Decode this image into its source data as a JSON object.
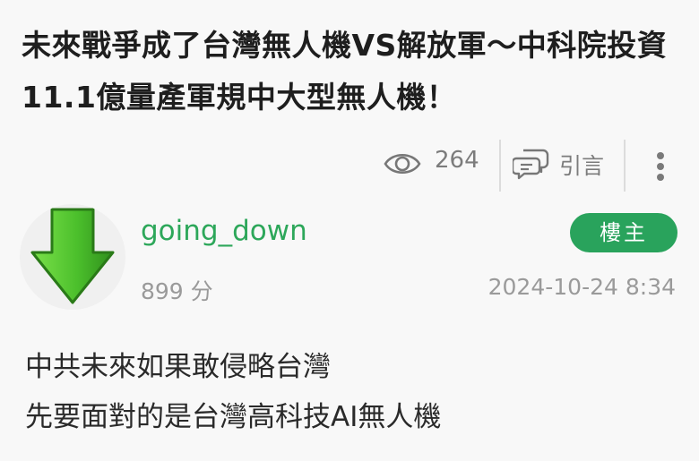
{
  "post": {
    "title": "未來戰爭成了台灣無人機VS解放軍～中科院投資11.1億量產軍規中大型無人機！",
    "views": "264",
    "quote_label": "引言",
    "author": {
      "name": "going_down",
      "points": "899 分",
      "badge": "樓主",
      "avatar_icon": "green-down-arrow-icon"
    },
    "timestamp": "2024-10-24 8:34",
    "body_lines": [
      "中共未來如果敢侵略台灣",
      "先要面對的是台灣高科技AI無人機"
    ]
  },
  "icons": {
    "views": "eye-icon",
    "quote": "quote-bubbles-icon",
    "more": "more-vertical-icon"
  },
  "colors": {
    "accent_green": "#29a35c",
    "username_green": "#2da75a",
    "muted_gray": "#9a9a9a"
  }
}
